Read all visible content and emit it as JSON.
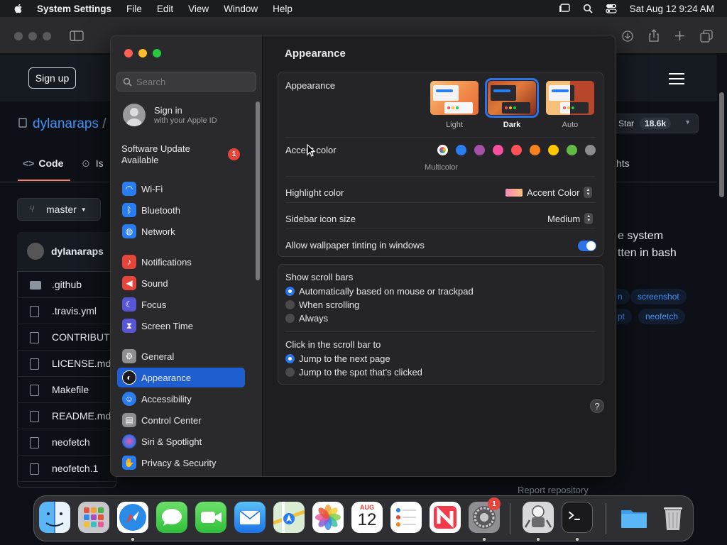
{
  "menubar": {
    "app_name": "System Settings",
    "menus": [
      "File",
      "Edit",
      "View",
      "Window",
      "Help"
    ],
    "clock": "Sat Aug 12  9:24 AM"
  },
  "github": {
    "signup_label": "Sign up",
    "repo_owner": "dylanaraps",
    "repo_sep": "/",
    "star_label": "Star",
    "star_count": "18.6k",
    "tabs": [
      "Code",
      "Is",
      "hts"
    ],
    "branch": "master",
    "commit_author": "dylanaraps",
    "files": [
      ".github",
      ".travis.yml",
      "CONTRIBUT",
      "LICENSE.md",
      "Makefile",
      "README.md",
      "neofetch",
      "neofetch.1"
    ],
    "about_lines": [
      "e system",
      "tten in bash"
    ],
    "topics": [
      "n",
      "screenshot",
      "pt",
      "neofetch"
    ],
    "report": "Report repository"
  },
  "settings": {
    "search_placeholder": "Search",
    "account": {
      "title": "Sign in",
      "subtitle": "with your Apple ID"
    },
    "software_update": {
      "line1": "Software Update",
      "line2": "Available",
      "badge": "1"
    },
    "sidebar_items": [
      {
        "label": "Wi-Fi",
        "icon": "wifi-icon",
        "color": "#2a7df0"
      },
      {
        "label": "Bluetooth",
        "icon": "bluetooth-icon",
        "color": "#2a7df0"
      },
      {
        "label": "Network",
        "icon": "globe-icon",
        "color": "#2a7df0"
      },
      {
        "label": "Notifications",
        "icon": "bell-icon",
        "color": "#e5453b"
      },
      {
        "label": "Sound",
        "icon": "speaker-icon",
        "color": "#e5453b"
      },
      {
        "label": "Focus",
        "icon": "moon-icon",
        "color": "#5856d6"
      },
      {
        "label": "Screen Time",
        "icon": "hourglass-icon",
        "color": "#5856d6"
      },
      {
        "label": "General",
        "icon": "gear-icon",
        "color": "#8e8e93"
      },
      {
        "label": "Appearance",
        "icon": "appearance-icon",
        "color": "#1c1c1e"
      },
      {
        "label": "Accessibility",
        "icon": "accessibility-icon",
        "color": "#2a7df0"
      },
      {
        "label": "Control Center",
        "icon": "control-center-icon",
        "color": "#8e8e93"
      },
      {
        "label": "Siri & Spotlight",
        "icon": "siri-icon",
        "color": "#3a2a6a"
      },
      {
        "label": "Privacy & Security",
        "icon": "hand-icon",
        "color": "#2a7df0"
      }
    ],
    "selected_item": "Appearance",
    "page_title": "Appearance",
    "appearance": {
      "label": "Appearance",
      "options": [
        "Light",
        "Dark",
        "Auto"
      ],
      "selected": "Dark"
    },
    "accent": {
      "label": "Accent color",
      "caption": "Multicolor",
      "colors": [
        "multicolor",
        "#2a7df0",
        "#a550a7",
        "#f74f9e",
        "#ff5257",
        "#f7821b",
        "#ffc600",
        "#62ba46",
        "#8c8c8c"
      ]
    },
    "highlight": {
      "label": "Highlight color",
      "value": "Accent Color"
    },
    "sidebar_icon_size": {
      "label": "Sidebar icon size",
      "value": "Medium"
    },
    "wallpaper_tinting": {
      "label": "Allow wallpaper tinting in windows",
      "on": true
    },
    "scroll_bars": {
      "label": "Show scroll bars",
      "options": [
        "Automatically based on mouse or trackpad",
        "When scrolling",
        "Always"
      ],
      "selected_index": 0
    },
    "click_scroll": {
      "label": "Click in the scroll bar to",
      "options": [
        "Jump to the next page",
        "Jump to the spot that’s clicked"
      ],
      "selected_index": 0
    },
    "help": "?"
  },
  "dock": {
    "apps": [
      "Finder",
      "Launchpad",
      "Safari",
      "Messages",
      "FaceTime",
      "Mail",
      "Maps",
      "Photos",
      "Calendar",
      "Reminders",
      "News",
      "System Settings",
      "Automator",
      "Terminal",
      "Downloads",
      "Trash"
    ],
    "calendar_month": "AUG",
    "calendar_day": "12",
    "settings_badge": "1"
  }
}
